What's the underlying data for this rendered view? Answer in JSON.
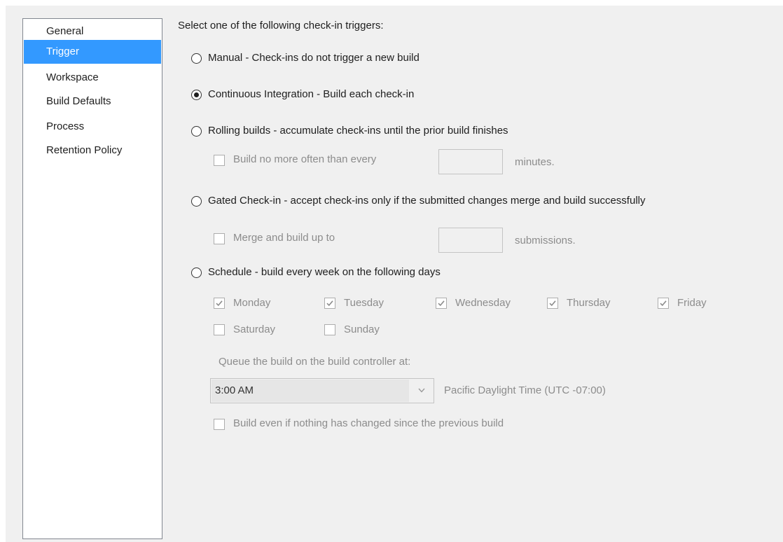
{
  "sidebar": {
    "items": [
      {
        "label": "General",
        "selected": false
      },
      {
        "label": "Trigger",
        "selected": true
      },
      {
        "label": "Workspace",
        "selected": false
      },
      {
        "label": "Build Defaults",
        "selected": false
      },
      {
        "label": "Process",
        "selected": false
      },
      {
        "label": "Retention Policy",
        "selected": false
      }
    ]
  },
  "trigger": {
    "heading": "Select one of the following check-in triggers:",
    "options": {
      "manual": {
        "label": "Manual - Check-ins do not trigger a new build",
        "checked": false
      },
      "ci": {
        "label": "Continuous Integration - Build each check-in",
        "checked": true
      },
      "rolling": {
        "label": "Rolling builds - accumulate check-ins until the prior build finishes",
        "checked": false
      },
      "gated": {
        "label": "Gated Check-in - accept check-ins only if the submitted changes merge and build successfully",
        "checked": false
      },
      "schedule": {
        "label": "Schedule - build every week on the following days",
        "checked": false
      }
    },
    "rolling_limit": {
      "label": "Build no more often than every",
      "value": "",
      "suffix": "minutes.",
      "checked": false
    },
    "gated_limit": {
      "label": "Merge and build up to",
      "value": "",
      "suffix": "submissions.",
      "checked": false
    },
    "days": {
      "monday": {
        "label": "Monday",
        "checked": true
      },
      "tuesday": {
        "label": "Tuesday",
        "checked": true
      },
      "wednesday": {
        "label": "Wednesday",
        "checked": true
      },
      "thursday": {
        "label": "Thursday",
        "checked": true
      },
      "friday": {
        "label": "Friday",
        "checked": true
      },
      "saturday": {
        "label": "Saturday",
        "checked": false
      },
      "sunday": {
        "label": "Sunday",
        "checked": false
      }
    },
    "queue_label": "Queue the build on the build controller at:",
    "time": {
      "value": "3:00 AM"
    },
    "timezone": "Pacific Daylight Time (UTC -07:00)",
    "build_even": {
      "label": "Build even if nothing has changed since the previous build",
      "checked": false
    }
  },
  "colors": {
    "selection": "#3399ff",
    "disabled_text": "#8c8c8c",
    "background": "#f0f0f0"
  }
}
